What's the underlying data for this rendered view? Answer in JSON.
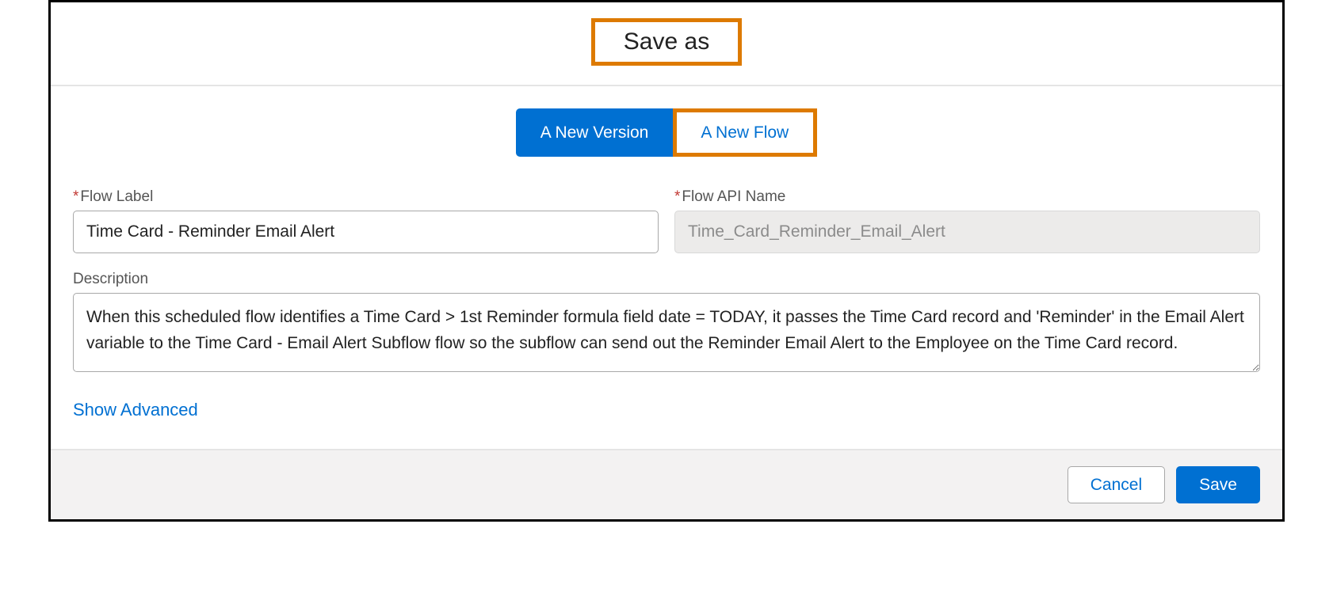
{
  "dialog": {
    "title": "Save as",
    "toggle": {
      "new_version": "A New Version",
      "new_flow": "A New Flow"
    },
    "fields": {
      "flow_label": {
        "label": "Flow Label",
        "value": "Time Card - Reminder Email Alert",
        "required": true
      },
      "flow_api_name": {
        "label": "Flow API Name",
        "value": "Time_Card_Reminder_Email_Alert",
        "required": true
      },
      "description": {
        "label": "Description",
        "value": "When this scheduled flow identifies a Time Card > 1st Reminder formula field date = TODAY, it passes the Time Card record and 'Reminder' in the Email Alert variable to the Time Card - Email Alert Subflow flow so the subflow can send out the Reminder Email Alert to the Employee on the Time Card record."
      }
    },
    "show_advanced": "Show Advanced",
    "buttons": {
      "cancel": "Cancel",
      "save": "Save"
    },
    "colors": {
      "brand": "#0070d2",
      "highlight": "#dd7a00",
      "required": "#c23934"
    }
  }
}
